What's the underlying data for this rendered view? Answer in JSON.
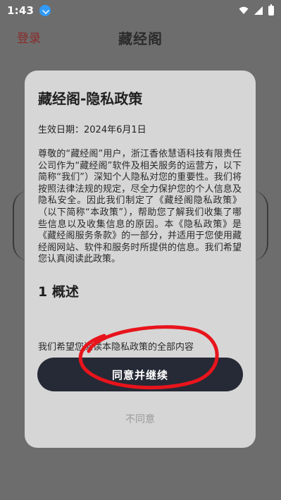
{
  "status_bar": {
    "time": "1:43",
    "download_icon": "download-icon",
    "wifi_icon": "wifi-icon",
    "signal_icon": "signal-icon",
    "battery_icon": "battery-icon"
  },
  "app_bar": {
    "login_label": "登录",
    "title": "藏经阁"
  },
  "dialog": {
    "title": "藏经阁-隐私政策",
    "effective_date": "生效日期：2024年6月1日",
    "body": "尊敬的“藏经阁”用户，浙江香依慧语科技有限责任公司作为“藏经阁”软件及相关服务的运营方，以下简称“我们”）深知个人隐私对您的重要性。我们将按照法律法规的规定，尽全力保护您的个人信息及隐私安全。因此我们制定了《藏经阁隐私政策》（以下简称“本政策”），帮助您了解我们收集了哪些信息以及收集信息的原因。本《隐私政策》是《藏经阁服务条款》的一部分，并适用于您使用藏经阁网站、软件和服务时所提供的信息。我们希望您认真阅读此政策。",
    "section_heading": "1 概述",
    "clipped_text": "我们希望您阅读本隐私政策的全部内容",
    "agree_label": "同意并继续",
    "disagree_label": "不同意"
  },
  "colors": {
    "overlay": "#6d6d6d",
    "dialog_bg": "#d6d6d6",
    "agree_bg": "#262a36",
    "login_text": "#8a2a2a",
    "annotation_red": "#e8141c"
  }
}
